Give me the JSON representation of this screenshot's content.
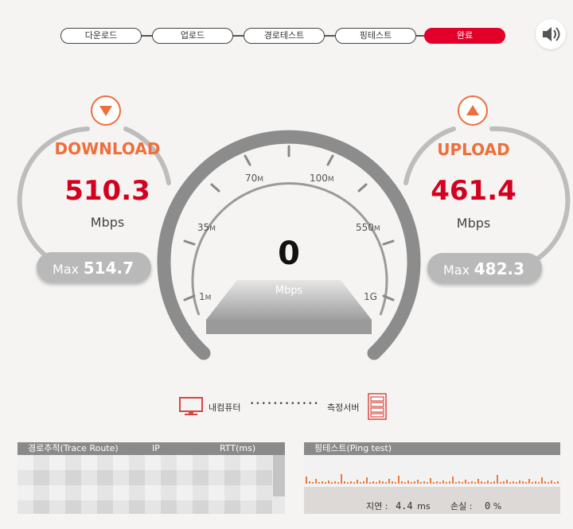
{
  "steps": [
    {
      "label": "다운로드",
      "active": false
    },
    {
      "label": "업로드",
      "active": false
    },
    {
      "label": "경로테스트",
      "active": false
    },
    {
      "label": "핑테스트",
      "active": false
    },
    {
      "label": "완료",
      "active": true
    }
  ],
  "download": {
    "title": "DOWNLOAD",
    "value": "510.3",
    "unit": "Mbps",
    "max_label": "Max",
    "max_value": "514.7"
  },
  "upload": {
    "title": "UPLOAD",
    "value": "461.4",
    "unit": "Mbps",
    "max_label": "Max",
    "max_value": "482.3"
  },
  "gauge": {
    "value": "0",
    "unit": "Mbps",
    "ticks": [
      {
        "num": "1",
        "suf": "M"
      },
      {
        "num": "35",
        "suf": "M"
      },
      {
        "num": "70",
        "suf": "M"
      },
      {
        "num": "100",
        "suf": "M"
      },
      {
        "num": "550",
        "suf": "M"
      },
      {
        "num": "1G",
        "suf": ""
      }
    ]
  },
  "connection": {
    "client_label": "내컴퓨터",
    "server_label": "측정서버",
    "dots": "••••••••••••"
  },
  "trace": {
    "headers": [
      "경로추적(Trace Route)",
      "IP",
      "RTT(ms)"
    ]
  },
  "ping": {
    "header": "핑테스트(Ping test)",
    "latency_label": "지연 :",
    "latency_value": "4.4",
    "latency_unit": "ms",
    "loss_label": "손실 :",
    "loss_value": "0",
    "loss_unit": "%"
  },
  "colors": {
    "accent": "#ee6f3c",
    "value_red": "#d4001f",
    "active_step": "#e2002b",
    "gray": "#8a8a8a"
  }
}
